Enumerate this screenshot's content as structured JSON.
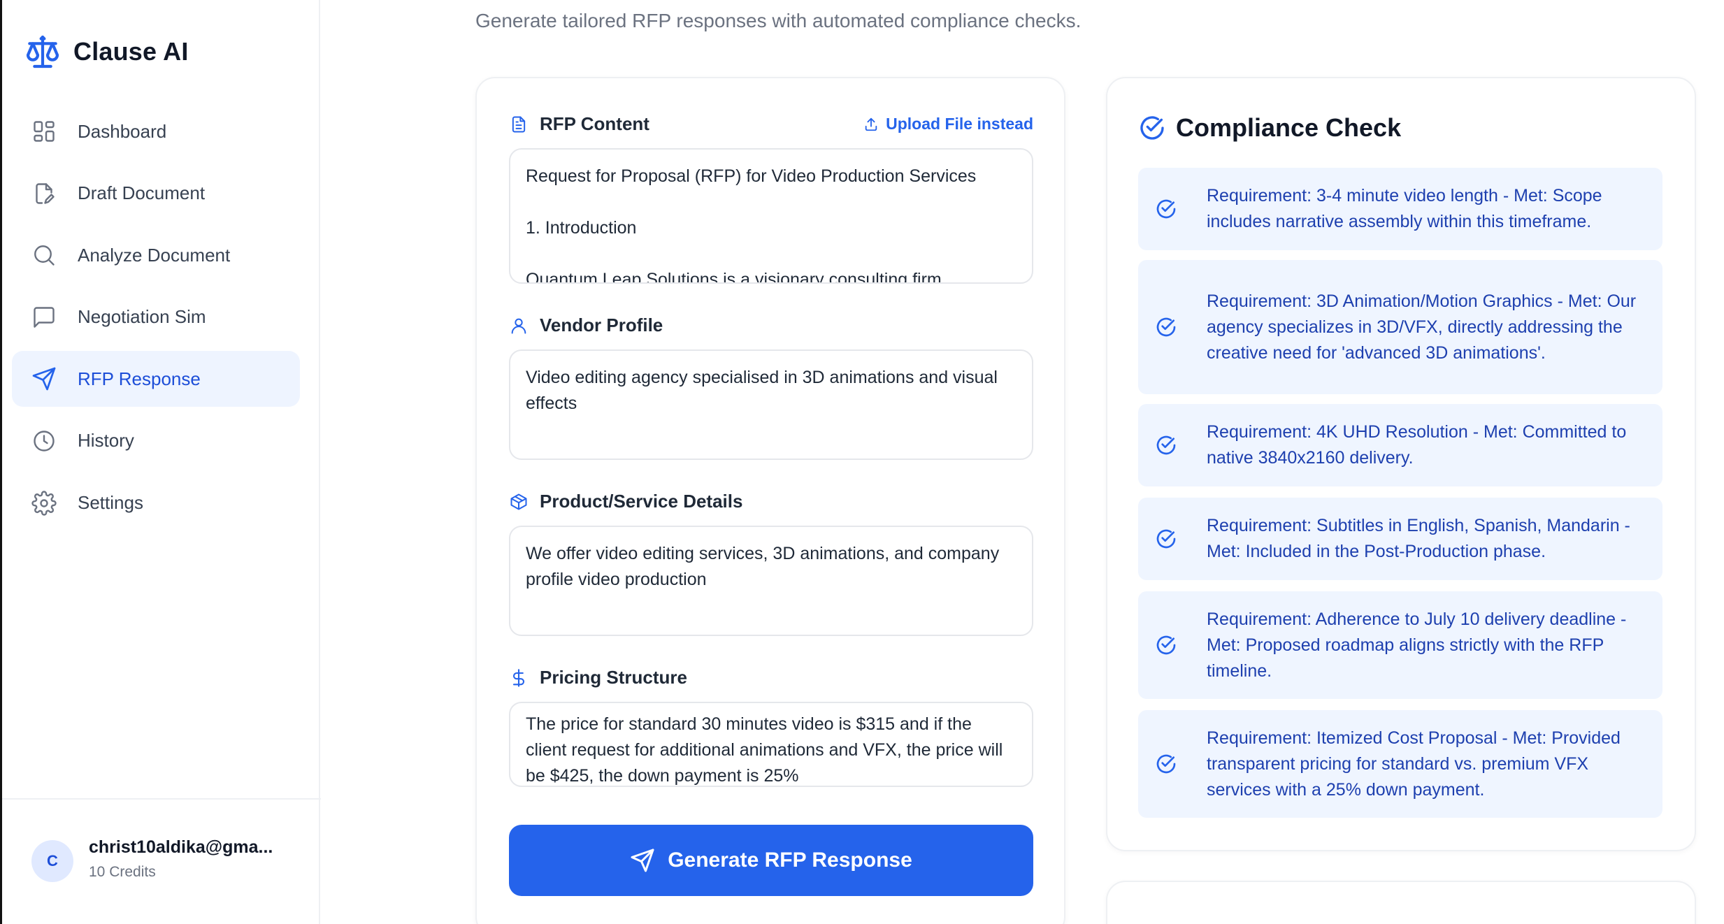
{
  "app": {
    "name": "Clause AI",
    "subtitle": "Generate tailored RFP responses with automated compliance checks."
  },
  "sidebar": {
    "items": [
      {
        "label": "Dashboard",
        "icon": "dashboard-icon"
      },
      {
        "label": "Draft Document",
        "icon": "document-edit-icon"
      },
      {
        "label": "Analyze Document",
        "icon": "search-icon"
      },
      {
        "label": "Negotiation Sim",
        "icon": "message-icon"
      },
      {
        "label": "RFP Response",
        "icon": "send-icon",
        "active": true
      },
      {
        "label": "History",
        "icon": "clock-icon"
      },
      {
        "label": "Settings",
        "icon": "gear-icon"
      }
    ],
    "user": {
      "initial": "C",
      "email": "christ10aldika@gma...",
      "credits": "10 Credits"
    }
  },
  "form": {
    "rfp": {
      "label": "RFP Content",
      "upload": "Upload File instead",
      "lines": [
        "Request for Proposal (RFP) for Video Production Services",
        "1. Introduction",
        "Quantum Leap Solutions is a visionary consulting firm"
      ]
    },
    "vendor": {
      "label": "Vendor Profile",
      "text": "Video editing agency specialised in 3D animations and visual effects"
    },
    "product": {
      "label": "Product/Service Details",
      "text": "We offer video editing services, 3D animations, and company profile video production"
    },
    "pricing": {
      "label": "Pricing Structure",
      "text": "The price for standard 30 minutes video is $315 and if the client request for additional animations and VFX, the price will be $425, the down payment is 25%"
    },
    "button": "Generate RFP Response"
  },
  "compliance": {
    "title": "Compliance Check",
    "items": [
      "Requirement: 3-4 minute video length - Met: Scope includes narrative assembly within this timeframe.",
      "Requirement: 3D Animation/Motion Graphics - Met: Our agency specializes in 3D/VFX, directly addressing the creative need for 'advanced 3D animations'.",
      "Requirement: 4K UHD Resolution - Met: Committed to native 3840x2160 delivery.",
      "Requirement: Subtitles in English, Spanish, Mandarin - Met: Included in the Post-Production phase.",
      "Requirement: Adherence to July 10 delivery deadline - Met: Proposed roadmap aligns strictly with the RFP timeline.",
      "Requirement: Itemized Cost Proposal - Met: Provided transparent pricing for standard vs. premium VFX services with a 25% down payment."
    ]
  },
  "colors": {
    "accent": "#2563eb",
    "active_bg": "#eef4ff",
    "req_bg": "#eff5ff",
    "req_text": "#1e40af"
  }
}
